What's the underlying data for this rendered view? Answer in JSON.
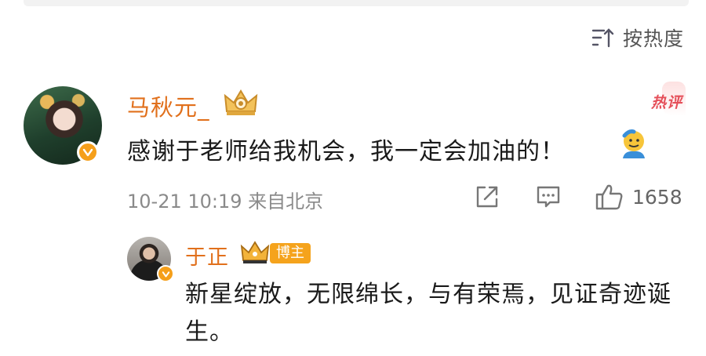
{
  "sort": {
    "label": "按热度"
  },
  "comment": {
    "username": "马秋元_",
    "hot_label": "热评",
    "text": "感谢于老师给我机会，我一定会加油的！",
    "timestamp": "10-21 10:19 来自北京",
    "like_count": "1658",
    "icons": [
      "share-icon",
      "comment-icon",
      "like-icon",
      "sort-icon",
      "crown-icon",
      "salute-emoji"
    ],
    "colors": {
      "username": "#e1701c",
      "badge": "#f59f1a",
      "hot": "#e5505a"
    }
  },
  "reply": {
    "username": "于正",
    "badge": "博主",
    "text": "新星绽放，无限绵长，与有荣焉，见证奇迹诞生。"
  }
}
